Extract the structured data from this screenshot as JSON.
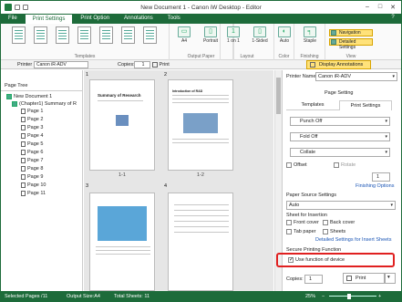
{
  "window": {
    "title": "New Document 1 - Canon iW Desktop - Editor"
  },
  "menu_tabs": [
    "File",
    "Print Settings",
    "Print Option",
    "Annotations",
    "Tools"
  ],
  "ribbon": {
    "templates_label": "Templates",
    "a4": "A4",
    "portrait": "Portrait",
    "one_on_1": "1 on 1",
    "one_sided": "1-Sided",
    "auto": "Auto",
    "staple": "Staple",
    "output_paper_label": "Output Paper",
    "layout_label": "Layout",
    "color_label": "Color",
    "finishing_label": "Finishing",
    "view_label": "View",
    "navigation": "Navigation",
    "detailed_settings": "Detailed Settings"
  },
  "toolbar": {
    "printer_label": "Printer",
    "printer_value": "Canon iR-ADV",
    "copies_label": "Copies:",
    "copies_value": "1",
    "print_button": "Print",
    "display_annotations": "Display Annotations"
  },
  "left_pane": {
    "header": "Page Tree",
    "tree": [
      "New Document 1",
      "(Chapter1) Summary of R",
      "Page 1",
      "Page 2",
      "Page 3",
      "Page 4",
      "Page 5",
      "Page 6",
      "Page 7",
      "Page 8",
      "Page 9",
      "Page 10",
      "Page 11"
    ]
  },
  "pages": [
    {
      "label": "1-1",
      "num": "1",
      "heading": "Summary of Research"
    },
    {
      "label": "1-2",
      "num": "2",
      "heading": "Introduction of R&D"
    },
    {
      "label": "",
      "num": "3"
    },
    {
      "label": "",
      "num": "4"
    }
  ],
  "right_pane": {
    "printer_name_label": "Printer Name:",
    "printer_name_value": "Canon iR-ADV",
    "page_setting_label": "Page Setting",
    "tabs": [
      "Templates",
      "Print Settings"
    ],
    "punch": "Punch Off",
    "fold": "Fold Off",
    "collate": "Collate",
    "offset_label": "Offset",
    "rotate_label": "Rotate",
    "offset_count": "1",
    "finishing_options": "Finishing Options",
    "paper_source_label": "Paper Source Settings",
    "paper_source_value": "Auto",
    "sheet_insertion_label": "Sheet for Insertion",
    "front_cover": "Front cover",
    "back_cover": "Back cover",
    "tab_paper": "Tab paper",
    "sheets": "Sheets",
    "detailed_sheets": "Detailed Settings for Insert Sheets",
    "secure_label": "Secure Printing Function",
    "use_function": "Use function of device",
    "copies_label": "Copies:",
    "copies_value": "1",
    "print_button": "Print"
  },
  "status": {
    "selected": "Selected Pages /11",
    "output_size": "Output Size:A4",
    "total": "Total Sheets: 11",
    "zoom": "25%"
  }
}
